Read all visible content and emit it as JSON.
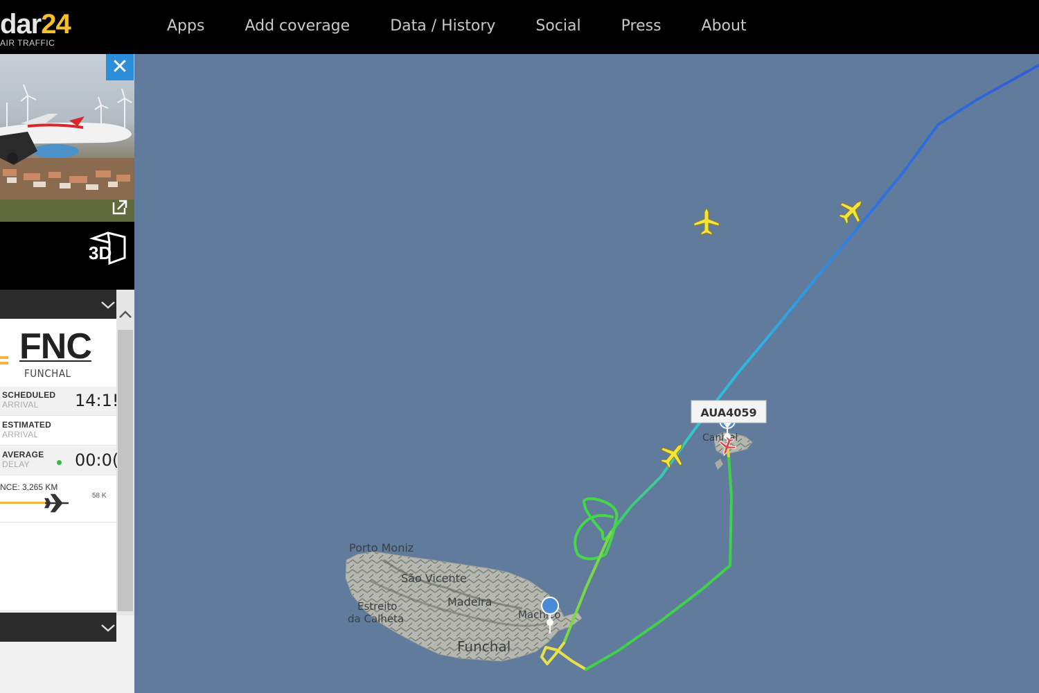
{
  "app": {
    "logo_prefix": "dar",
    "logo_number": "24",
    "logo_tagline": "AIR TRAFFIC"
  },
  "nav": {
    "items": [
      "Apps",
      "Add coverage",
      "Data / History",
      "Social",
      "Press",
      "About"
    ]
  },
  "panel": {
    "close_icon": "close-icon",
    "external_link_icon": "external-link-icon",
    "view_3d_label": "3D",
    "arrival": {
      "code": "FNC",
      "city": "FUNCHAL",
      "scheduled": {
        "label1": "SCHEDULED",
        "label2": "ARRIVAL",
        "value": "14:1!"
      },
      "estimated": {
        "label1": "ESTIMATED",
        "label2": "ARRIVAL",
        "value": ""
      },
      "delay": {
        "label1": "AVERAGE",
        "label2": "DELAY",
        "value": "00:0("
      },
      "distance_label": "NCE: 3,265 KM",
      "distance_right": "58 K",
      "progress_fraction": 0.42
    }
  },
  "map": {
    "flight_label": "AUA4059",
    "places": {
      "porto_moniz": "Porto Moniz",
      "sao_vicente": "São Vicente",
      "madeira": "Madeira",
      "machico": "Machico",
      "estreito1": "Estreito",
      "estreito2": "da Calheta",
      "funchal": "Funchal",
      "canico": "Caniçal"
    },
    "colors": {
      "sea": "#617b9d",
      "track_high": "#2e5fd6",
      "track_mid": "#2fb8e0",
      "track_low": "#3fd14a",
      "track_ground": "#e8e04a",
      "aircraft": "#f5e43a"
    }
  }
}
